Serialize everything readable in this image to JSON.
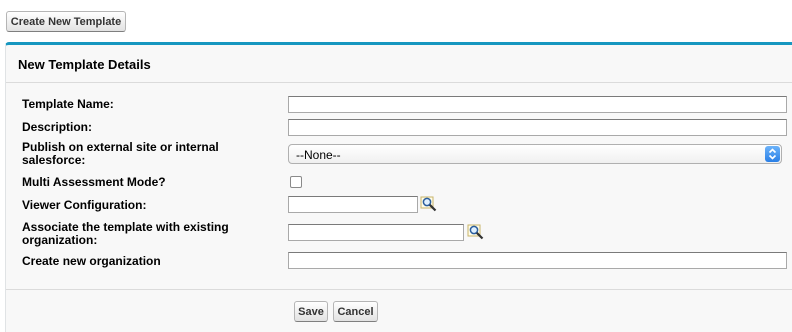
{
  "toolbar": {
    "create_label": "Create New Template"
  },
  "panel": {
    "title": "New Template Details"
  },
  "form": {
    "template_name": {
      "label": "Template Name:",
      "value": ""
    },
    "description": {
      "label": "Description:",
      "value": ""
    },
    "publish": {
      "label": "Publish on external site or internal salesforce:",
      "selected": "--None--"
    },
    "multi_assessment": {
      "label": "Multi Assessment Mode?",
      "checked": false
    },
    "viewer_configuration": {
      "label": "Viewer Configuration:",
      "value": ""
    },
    "associate_org": {
      "label": "Associate the template with existing organization:",
      "value": ""
    },
    "create_org": {
      "label": "Create new organization",
      "value": ""
    }
  },
  "actions": {
    "save_label": "Save",
    "cancel_label": "Cancel"
  },
  "colors": {
    "accent": "#1797c0",
    "select_arrow": "#2a7fe6"
  },
  "icons": {
    "lookup": "magnifier-lookup-icon",
    "select_arrow": "chevron-updown-icon"
  }
}
